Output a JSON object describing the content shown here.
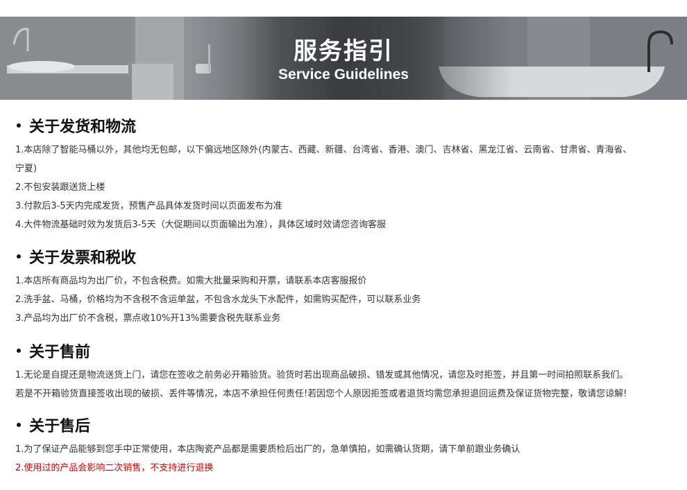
{
  "banner": {
    "title": "服务指引",
    "subtitle": "Service Guidelines"
  },
  "sections": [
    {
      "heading": "关于发货和物流",
      "lines": [
        "1.本店除了智能马桶以外，其他均无包邮，以下偏远地区除外(内蒙古、西藏、新疆、台湾省、香港、澳门、吉林省、黑龙江省、云南省、甘肃省、青海省、",
        "宁夏)",
        "2.不包安装跟送货上楼",
        "3.付款后3-5天内完成发货，预售产品具体发货时间以页面发布为准",
        "4.大件物流基础时效为发货后3-5天（大促期间以页面输出为准），具体区域时效请您咨询客服"
      ]
    },
    {
      "heading": "关于发票和税收",
      "lines": [
        "1.本店所有商品均为出厂价，不包含税费。如需大批量采购和开票，请联系本店客服报价",
        "2.洗手盆、马桶，价格均为不含税不含运单盆，不包含水龙头下水配件，如需购买配件，可以联系业务",
        "3.产品均为出厂价不含税，票点收10%开13%需要含税先联系业务"
      ]
    },
    {
      "heading": "关于售前",
      "lines": [
        "1.无论是自提还是物流送货上门，请您在签收之前务必开箱验货。验货时若出现商品破损、错发或其他情况，请您及时拒签，并且第一时间拍照联系我们。",
        "若是不开箱验货直接签收出现的破损、丢件等情况，本店不承担任何责任!若因您个人原因拒签或者退货均需您承担退回运费及保证货物完整，敬请您谅解!"
      ]
    },
    {
      "heading": "关于售后",
      "lines": [
        "1.为了保证产品能够到您手中正常使用，本店陶瓷产品都是需要质检后出厂的，急单慎拍，如需确认货期，请下单前跟业务确认",
        "2.使用过的产品会影响二次销售，不支持进行退换"
      ],
      "highlight_color": "#cc0000"
    }
  ]
}
